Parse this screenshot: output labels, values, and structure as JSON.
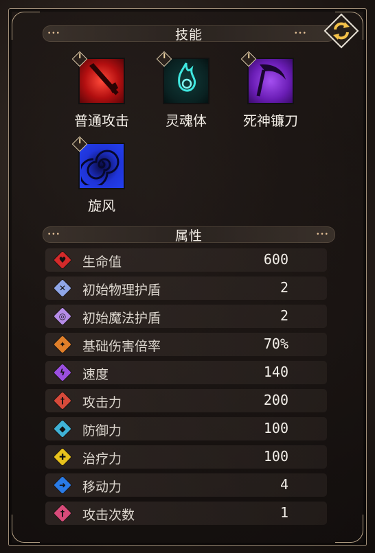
{
  "skills_header": {
    "title": "技能"
  },
  "attributes_header": {
    "title": "属性"
  },
  "skills": [
    {
      "name": "普通攻击",
      "icon": "sword-thrust-icon",
      "color": "#c81818"
    },
    {
      "name": "灵魂体",
      "icon": "spirit-flame-icon",
      "color": "#0c9a8e"
    },
    {
      "name": "死神镰刀",
      "icon": "scythe-icon",
      "color": "#7a2fc9"
    },
    {
      "name": "旋风",
      "icon": "whirlwind-icon",
      "color": "#1f34d8"
    }
  ],
  "stats": [
    {
      "name": "生命值",
      "value": "600",
      "icon": "heart-icon",
      "color": "#d42a2a"
    },
    {
      "name": "初始物理护盾",
      "value": "2",
      "icon": "physical-shield-icon",
      "color": "#8fa6e8"
    },
    {
      "name": "初始魔法护盾",
      "value": "2",
      "icon": "magic-shield-icon",
      "color": "#b58be6"
    },
    {
      "name": "基础伤害倍率",
      "value": "70%",
      "icon": "damage-multiplier-icon",
      "color": "#e07f2a"
    },
    {
      "name": "速度",
      "value": "140",
      "icon": "speed-icon",
      "color": "#9b4fe0"
    },
    {
      "name": "攻击力",
      "value": "200",
      "icon": "attack-icon",
      "color": "#d64a3a"
    },
    {
      "name": "防御力",
      "value": "100",
      "icon": "defense-icon",
      "color": "#3fb2d6"
    },
    {
      "name": "治疗力",
      "value": "100",
      "icon": "healing-icon",
      "color": "#e8c21c"
    },
    {
      "name": "移动力",
      "value": "4",
      "icon": "movement-icon",
      "color": "#2a7be6"
    },
    {
      "name": "攻击次数",
      "value": "1",
      "icon": "attack-count-icon",
      "color": "#d84b7a"
    }
  ],
  "info_badge_glyph": "i",
  "header_dots": "•••",
  "swap_icon": "swap-arrows-icon"
}
